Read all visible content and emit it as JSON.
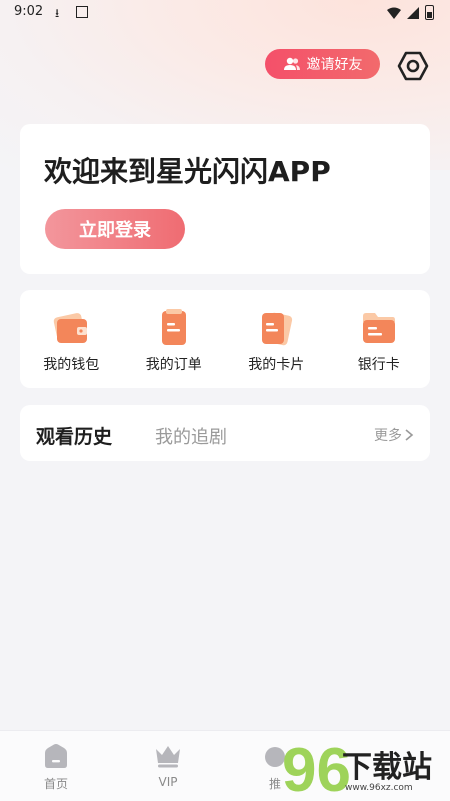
{
  "status_bar": {
    "time": "9:02"
  },
  "header": {
    "invite_label": "邀请好友"
  },
  "welcome": {
    "title": "欢迎来到星光闪闪APP",
    "login_label": "立即登录"
  },
  "shortcuts": [
    {
      "label": "我的钱包",
      "icon": "wallet-icon"
    },
    {
      "label": "我的订单",
      "icon": "order-icon"
    },
    {
      "label": "我的卡片",
      "icon": "card-icon"
    },
    {
      "label": "银行卡",
      "icon": "bank-card-icon"
    }
  ],
  "history": {
    "tab_history": "观看历史",
    "tab_drama": "我的追剧",
    "more_label": "更多"
  },
  "bottom_nav": [
    {
      "label": "首页",
      "icon": "home-icon"
    },
    {
      "label": "VIP",
      "icon": "crown-icon"
    },
    {
      "label": "推",
      "icon": "recommend-icon"
    }
  ],
  "watermark": {
    "text": "下载站",
    "number": "96",
    "url": "www.96xz.com"
  },
  "colors": {
    "accent": "#f4506a",
    "login_start": "#f3969c",
    "login_end": "#ef6c72",
    "icon_orange": "#f3865a"
  }
}
